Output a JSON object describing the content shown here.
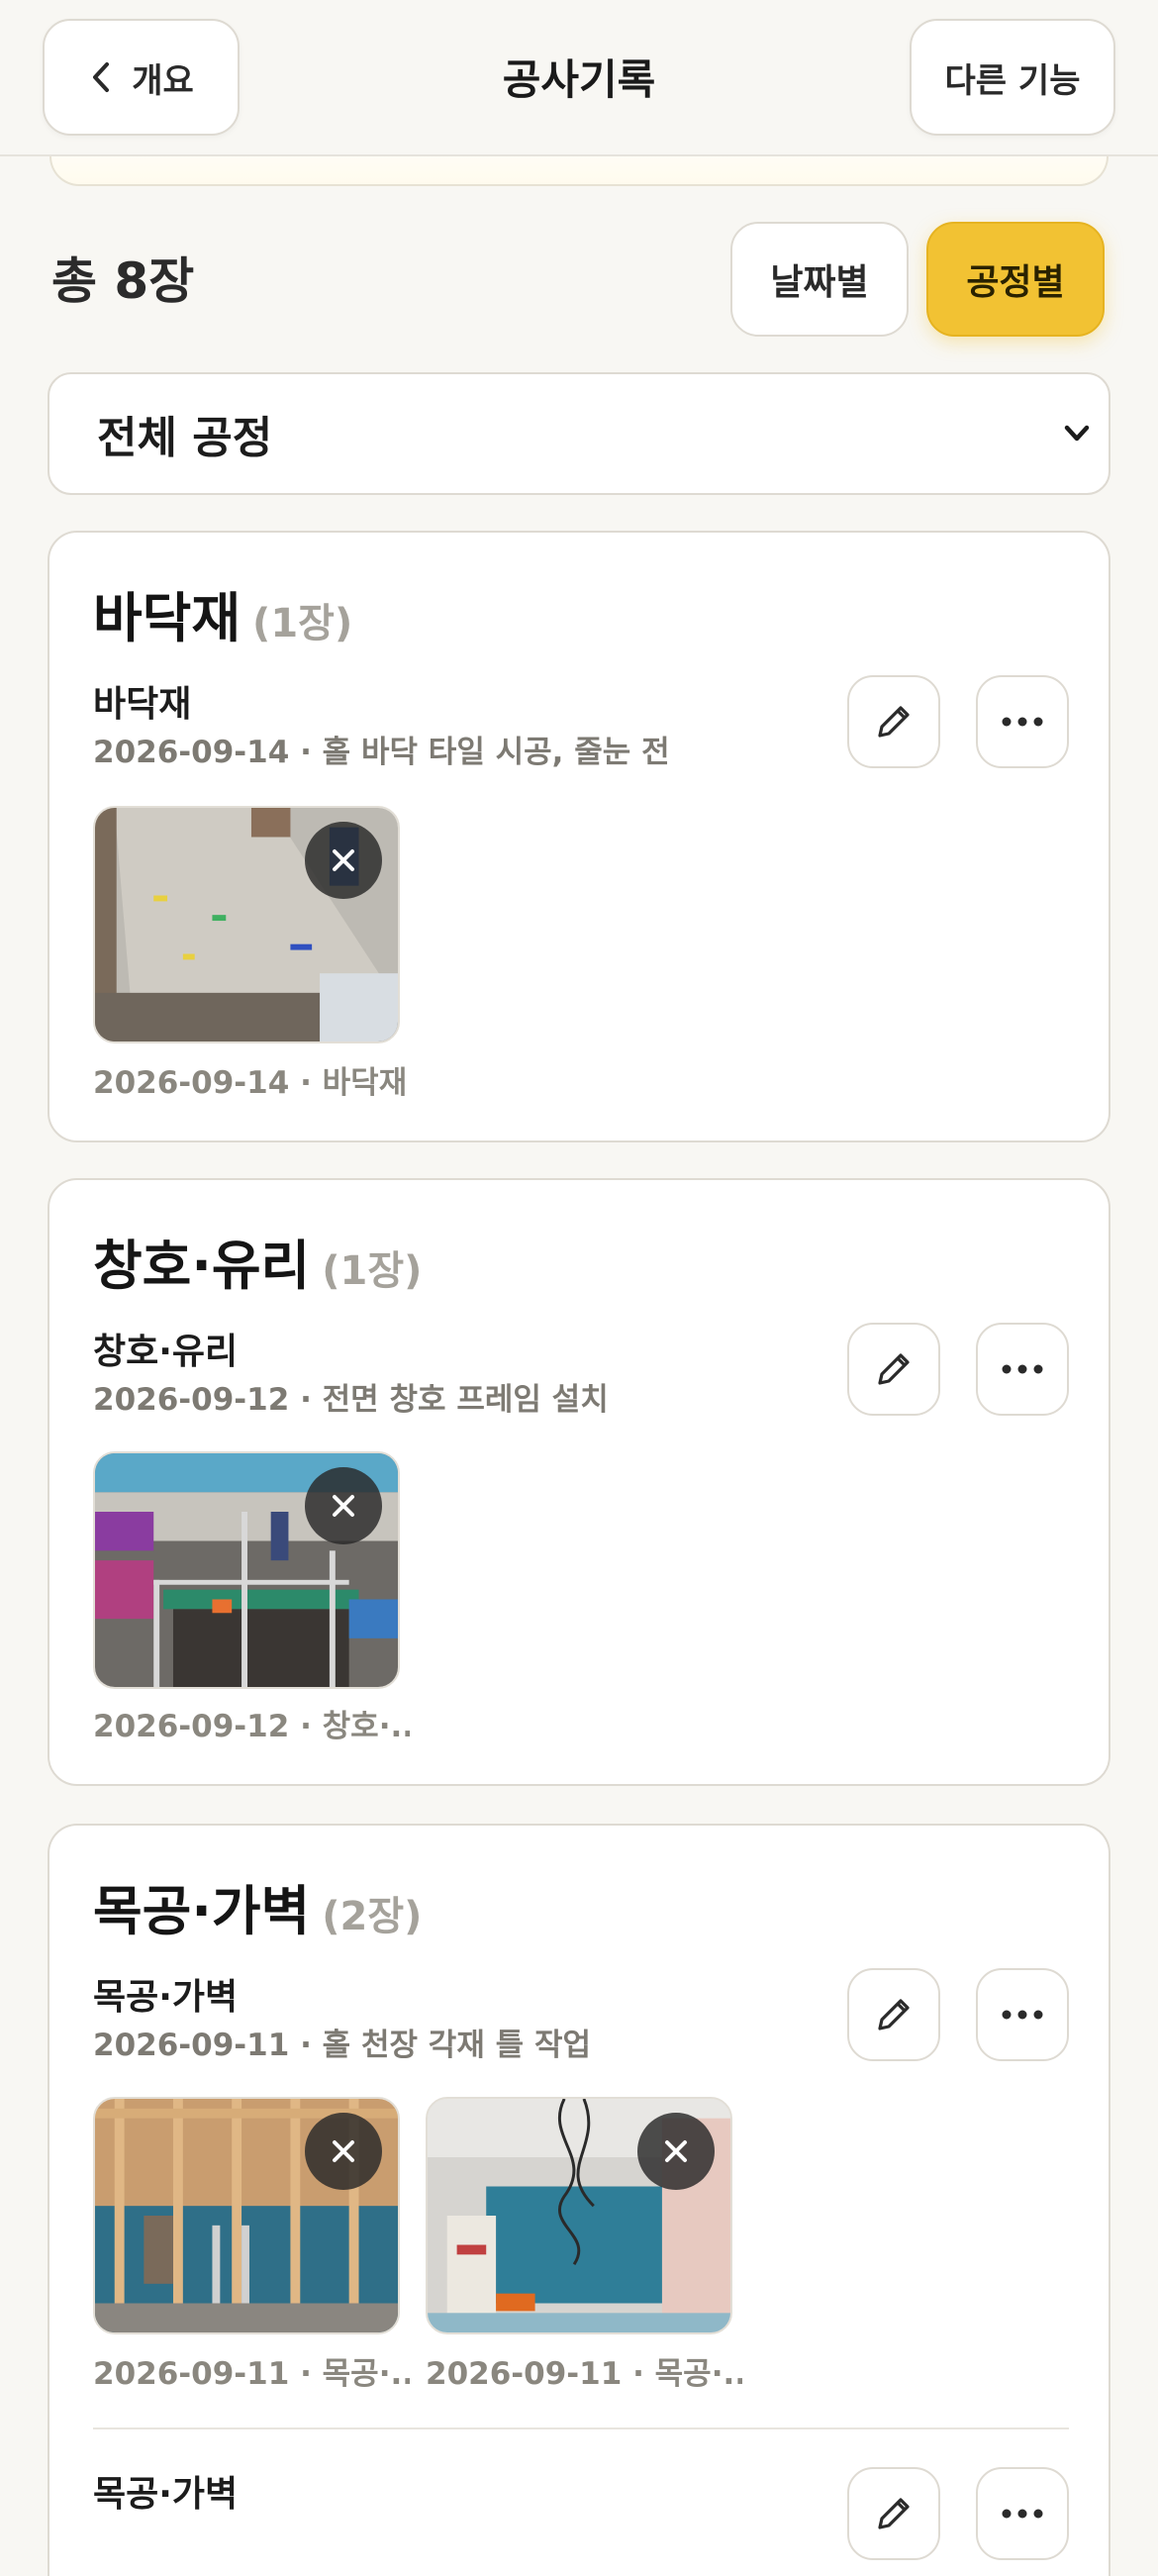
{
  "header": {
    "back_label": "개요",
    "title": "공사기록",
    "more_label": "다른 기능"
  },
  "summary": {
    "total_label": "총 8장"
  },
  "view_toggle": {
    "date_label": "날짜별",
    "process_label": "공정별",
    "active": "process"
  },
  "filter": {
    "selected": "전체 공정"
  },
  "groups": [
    {
      "name": "바닥재",
      "count_label": "(1장)",
      "entries": [
        {
          "title": "바닥재",
          "meta": "2026-09-14 · 홀 바닥 타일 시공, 줄눈 전",
          "photos": [
            {
              "caption": "2026-09-14 · 바닥재"
            }
          ]
        }
      ]
    },
    {
      "name": "창호·유리",
      "count_label": "(1장)",
      "entries": [
        {
          "title": "창호·유리",
          "meta": "2026-09-12 · 전면 창호 프레임 설치",
          "photos": [
            {
              "caption": "2026-09-12 · 창호·..."
            }
          ]
        }
      ]
    },
    {
      "name": "목공·가벽",
      "count_label": "(2장)",
      "entries": [
        {
          "title": "목공·가벽",
          "meta": "2026-09-11 · 홀 천장 각재 틀 작업",
          "photos": [
            {
              "caption": "2026-09-11 · 목공·..."
            },
            {
              "caption": "2026-09-11 · 목공·..."
            }
          ]
        },
        {
          "title": "목공·가벽"
        }
      ]
    }
  ],
  "colors": {
    "accent": "#f2c233",
    "background": "#f8f7f3",
    "card_border": "#dedad2",
    "muted_text": "#7d7a73"
  },
  "icons": {
    "back": "chevron-left-icon",
    "filter": "chevron-down-icon",
    "edit": "pencil-icon",
    "more": "ellipsis-icon",
    "remove_photo": "close-icon"
  }
}
